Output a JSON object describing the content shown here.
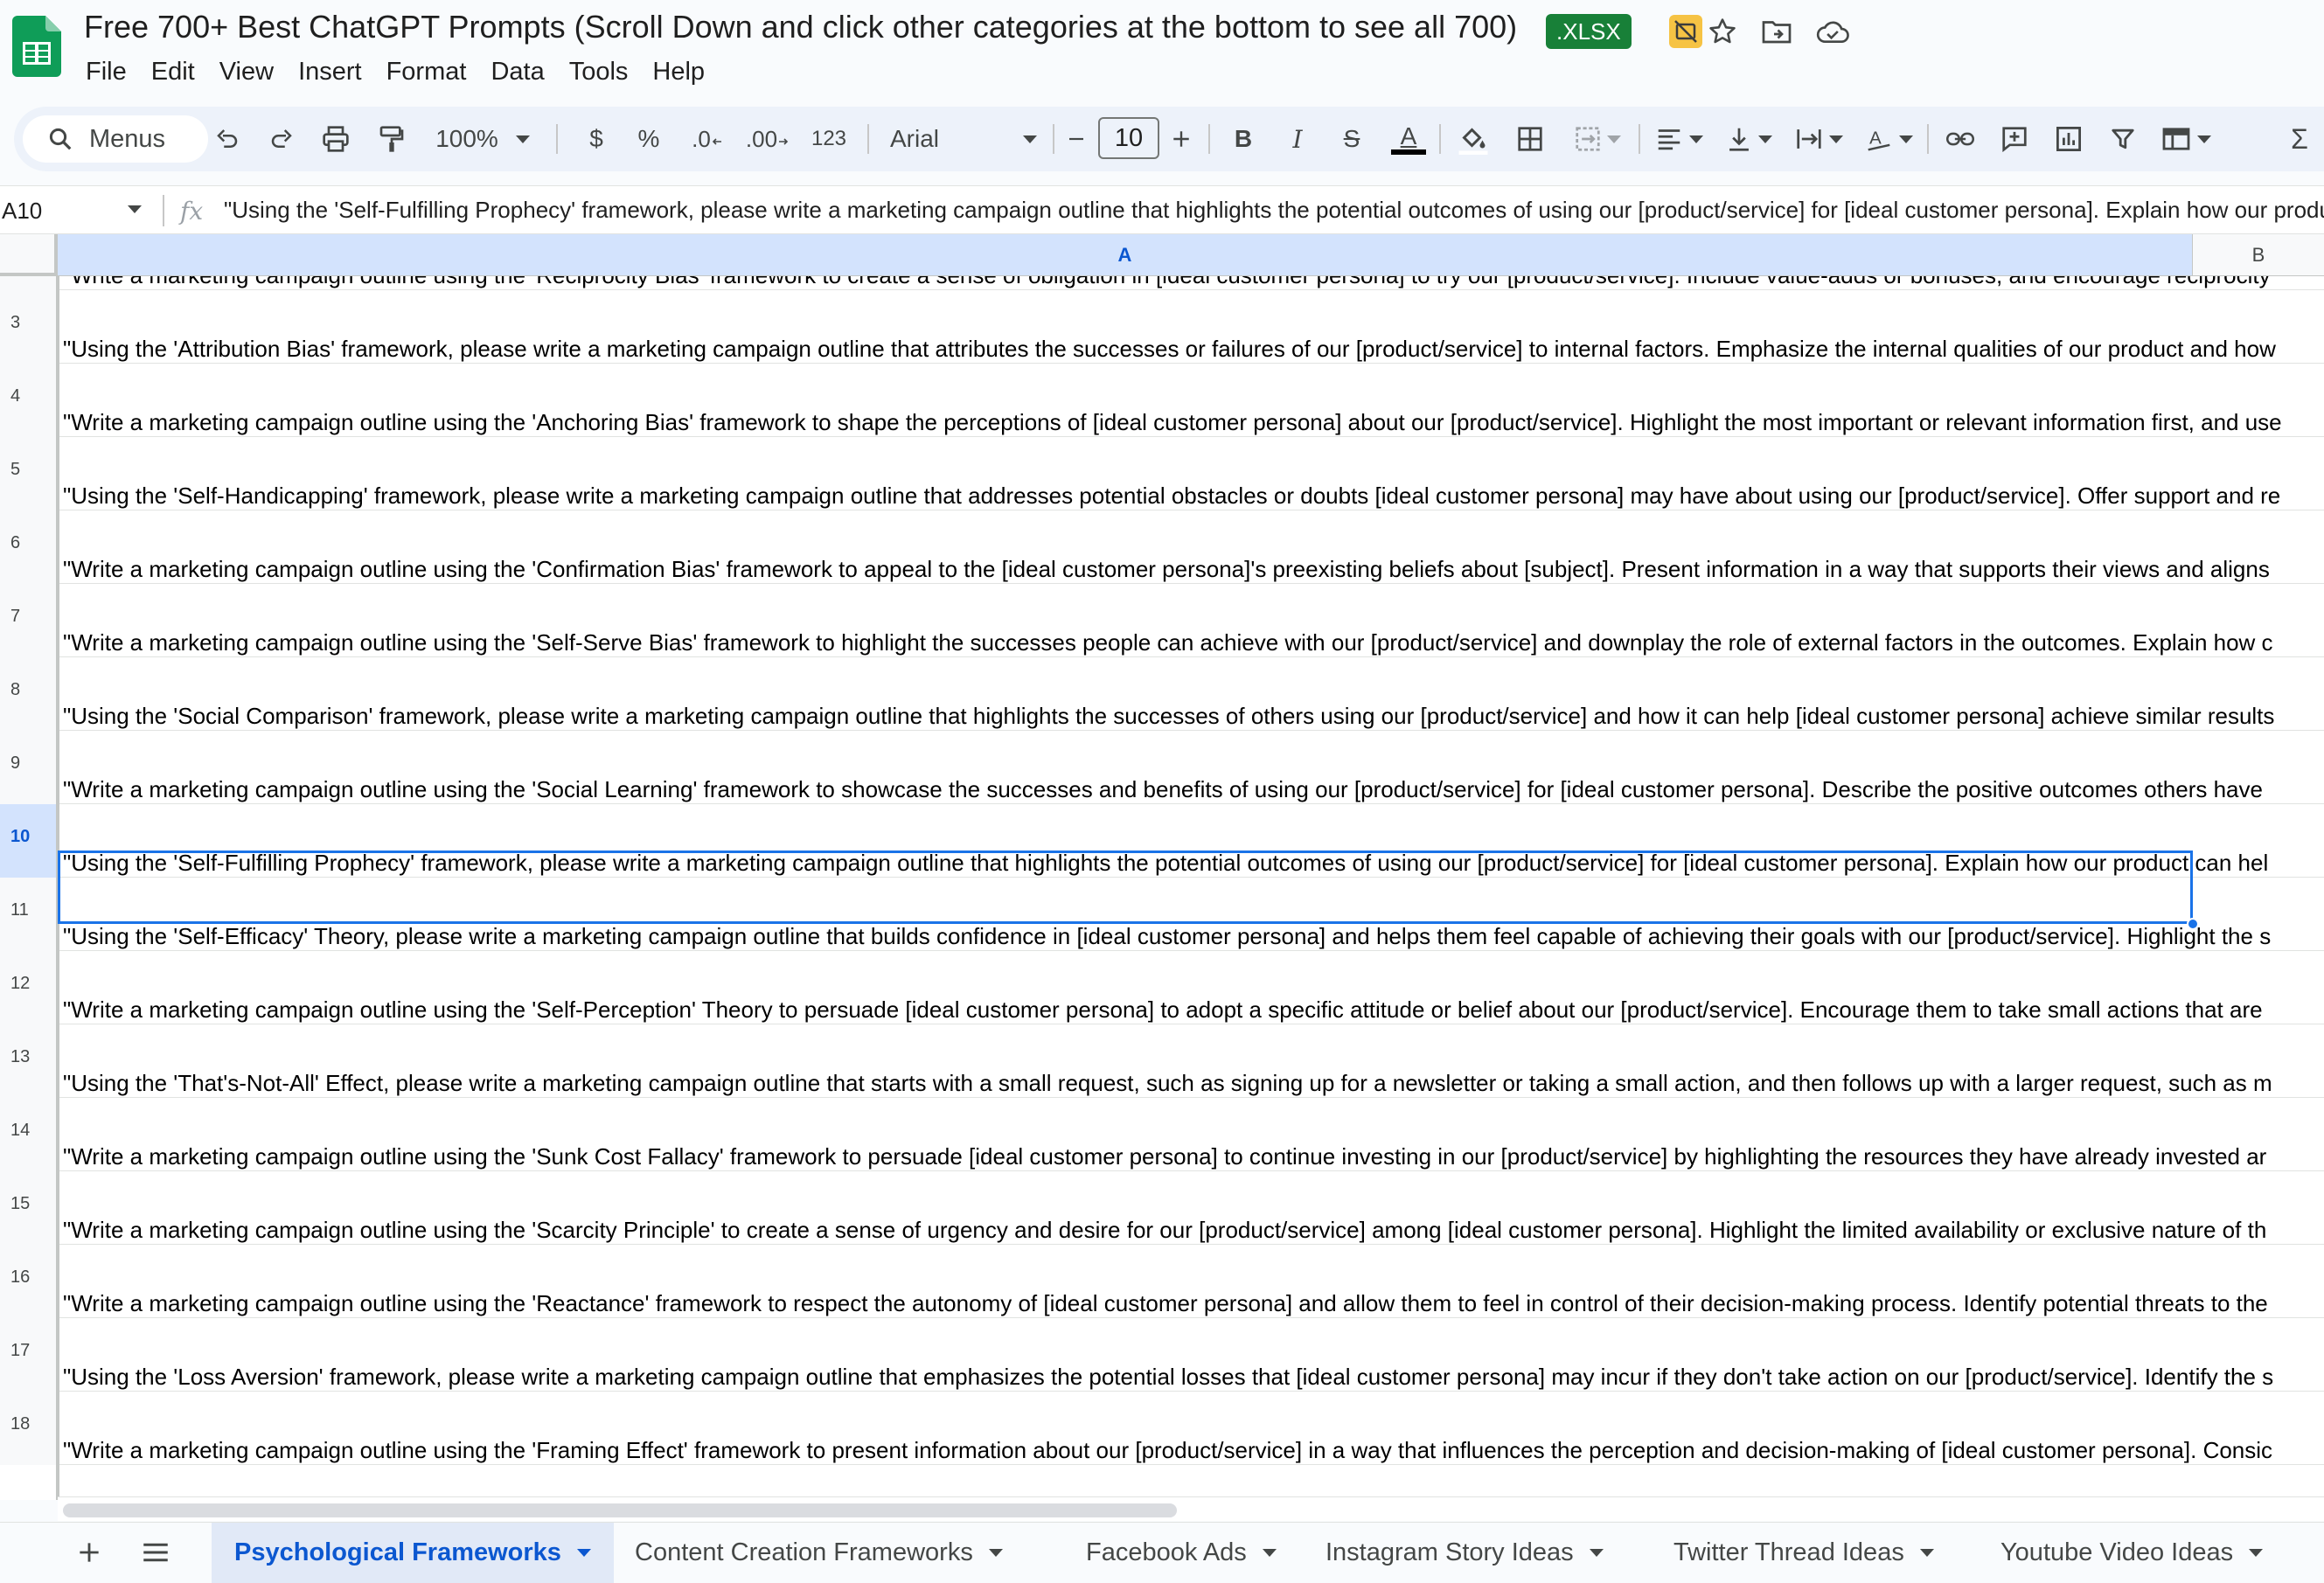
{
  "document": {
    "title": "Free 700+ Best ChatGPT Prompts (Scroll Down and click other categories at the bottom to see all 700)",
    "file_badge": ".XLSX"
  },
  "menubar": [
    "File",
    "Edit",
    "View",
    "Insert",
    "Format",
    "Data",
    "Tools",
    "Help"
  ],
  "toolbar": {
    "search_label": "Menus",
    "zoom": "100%",
    "currency": "$",
    "percent": "%",
    "decrease_decimal": ".0",
    "increase_decimal": ".00",
    "more_formats": "123",
    "font": "Arial",
    "font_size": "10",
    "bold": "B",
    "italic": "I",
    "strikethrough": "S",
    "text_color_letter": "A",
    "text_color": "#000000"
  },
  "formula_bar": {
    "name_box": "A10",
    "fx": "fx",
    "content": "\"Using the 'Self-Fulfilling Prophecy' framework, please write a marketing campaign outline that highlights the potential outcomes of using our [product/service] for [ideal customer persona]. Explain how our product can he"
  },
  "columns": [
    "A",
    "B"
  ],
  "partial_top_row": "\"Write a marketing campaign outline using the 'Reciprocity Bias' framework to create a sense of obligation in [ideal customer persona] to try our [product/service]. Include value-adds or bonuses, and encourage reciprocity",
  "rows": [
    {
      "num": "3",
      "text": "\"Using the 'Attribution Bias' framework, please write a marketing campaign outline that attributes the successes or failures of our [product/service] to internal factors. Emphasize the internal qualities of our product and how"
    },
    {
      "num": "4",
      "text": "\"Write a marketing campaign outline using the 'Anchoring Bias' framework to shape the perceptions of [ideal customer persona] about our [product/service]. Highlight the most important or relevant information first, and use"
    },
    {
      "num": "5",
      "text": "\"Using the 'Self-Handicapping' framework, please write a marketing campaign outline that addresses potential obstacles or doubts [ideal customer persona] may have about using our [product/service]. Offer support and re"
    },
    {
      "num": "6",
      "text": "\"Write a marketing campaign outline using the 'Confirmation Bias' framework to appeal to the [ideal customer persona]'s preexisting beliefs about [subject]. Present information in a way that supports their views and aligns"
    },
    {
      "num": "7",
      "text": "\"Write a marketing campaign outline using the 'Self-Serve Bias' framework to highlight the successes people can achieve with our [product/service] and downplay the role of external factors in the outcomes. Explain how c"
    },
    {
      "num": "8",
      "text": "\"Using the 'Social Comparison' framework, please write a marketing campaign outline that highlights the successes of others using our [product/service] and how it can help [ideal customer persona] achieve similar results"
    },
    {
      "num": "9",
      "text": "\"Write a marketing campaign outline using the 'Social Learning' framework to showcase the successes and benefits of using our [product/service] for [ideal customer persona]. Describe the positive outcomes others have"
    },
    {
      "num": "10",
      "text": "\"Using the 'Self-Fulfilling Prophecy' framework, please write a marketing campaign outline that highlights the potential outcomes of using our [product/service] for [ideal customer persona]. Explain how our product can hel"
    },
    {
      "num": "11",
      "text": "\"Using the 'Self-Efficacy' Theory, please write a marketing campaign outline that builds confidence in [ideal customer persona] and helps them feel capable of achieving their goals with our [product/service]. Highlight the s"
    },
    {
      "num": "12",
      "text": "\"Write a marketing campaign outline using the 'Self-Perception' Theory to persuade [ideal customer persona] to adopt a specific attitude or belief about our [product/service]. Encourage them to take small actions that are"
    },
    {
      "num": "13",
      "text": "\"Using the 'That's-Not-All' Effect, please write a marketing campaign outline that starts with a small request, such as signing up for a newsletter or taking a small action, and then follows up with a larger request, such as m"
    },
    {
      "num": "14",
      "text": "\"Write a marketing campaign outline using the 'Sunk Cost Fallacy' framework to persuade [ideal customer persona] to continue investing in our [product/service] by highlighting the resources they have already invested ar"
    },
    {
      "num": "15",
      "text": "\"Write a marketing campaign outline using the 'Scarcity Principle' to create a sense of urgency and desire for our [product/service] among [ideal customer persona]. Highlight the limited availability or exclusive nature of th"
    },
    {
      "num": "16",
      "text": "\"Write a marketing campaign outline using the 'Reactance' framework to respect the autonomy of [ideal customer persona] and allow them to feel in control of their decision-making process. Identify potential threats to the"
    },
    {
      "num": "17",
      "text": "\"Using the 'Loss Aversion' framework, please write a marketing campaign outline that emphasizes the potential losses that [ideal customer persona] may incur if they don't take action on our [product/service]. Identify the s"
    },
    {
      "num": "18",
      "text": "\"Write a marketing campaign outline using the 'Framing Effect' framework to present information about our [product/service] in a way that influences the perception and decision-making of [ideal customer persona]. Consic"
    }
  ],
  "selected_row": "10",
  "sheet_tabs": [
    {
      "label": "Psychological Frameworks",
      "active": true
    },
    {
      "label": "Content Creation Frameworks",
      "active": false
    },
    {
      "label": "Facebook Ads",
      "active": false
    },
    {
      "label": "Instagram Story Ideas",
      "active": false
    },
    {
      "label": "Twitter Thread Ideas",
      "active": false
    },
    {
      "label": "Youtube Video Ideas",
      "active": false
    }
  ],
  "colors": {
    "accent": "#0b57d0",
    "selection": "#1a73e8",
    "sheets_green": "#0f9d58",
    "xlsx_badge": "#188038",
    "protect_badge": "#f6c344"
  }
}
